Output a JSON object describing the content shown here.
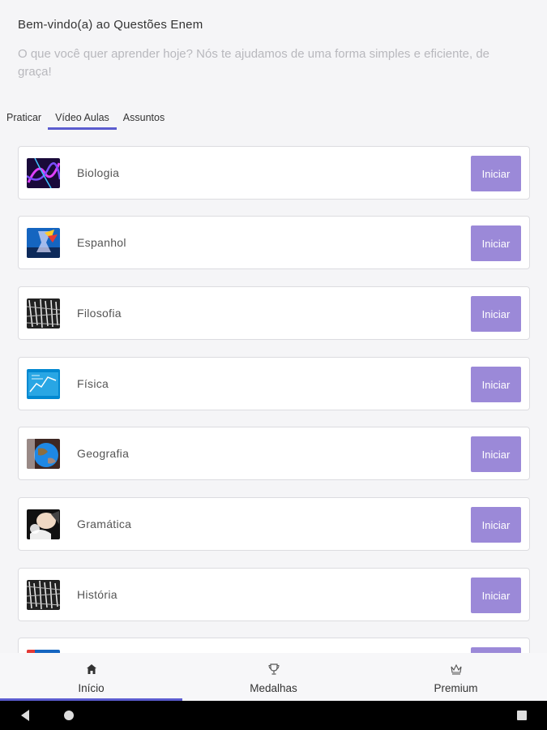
{
  "header": {
    "welcome": "Bem-vindo(a) ao Questões Enem",
    "subtitle": "O que você quer aprender hoje? Nós te ajudamos de uma forma simples e eficiente, de graça!"
  },
  "tabs": [
    {
      "label": "Praticar",
      "active": false
    },
    {
      "label": "Vídeo Aulas",
      "active": true
    },
    {
      "label": "Assuntos",
      "active": false
    }
  ],
  "subjects": [
    {
      "name": "Biologia",
      "icon": "biologia-thumbnail",
      "button": "Iniciar"
    },
    {
      "name": "Espanhol",
      "icon": "espanhol-thumbnail",
      "button": "Iniciar"
    },
    {
      "name": "Filosofia",
      "icon": "filosofia-thumbnail",
      "button": "Iniciar"
    },
    {
      "name": "Física",
      "icon": "fisica-thumbnail",
      "button": "Iniciar"
    },
    {
      "name": "Geografia",
      "icon": "geografia-thumbnail",
      "button": "Iniciar"
    },
    {
      "name": "Gramática",
      "icon": "gramatica-thumbnail",
      "button": "Iniciar"
    },
    {
      "name": "História",
      "icon": "historia-thumbnail",
      "button": "Iniciar"
    },
    {
      "name": "",
      "icon": "partial-thumbnail",
      "button": ""
    }
  ],
  "bottom_nav": [
    {
      "label": "Início",
      "icon": "home-icon",
      "active": true
    },
    {
      "label": "Medalhas",
      "icon": "trophy-icon",
      "active": false
    },
    {
      "label": "Premium",
      "icon": "crown-icon",
      "active": false
    }
  ],
  "colors": {
    "accent": "#5b5ccf",
    "button": "#9b89d8",
    "subtitle": "#b8b8bd"
  }
}
